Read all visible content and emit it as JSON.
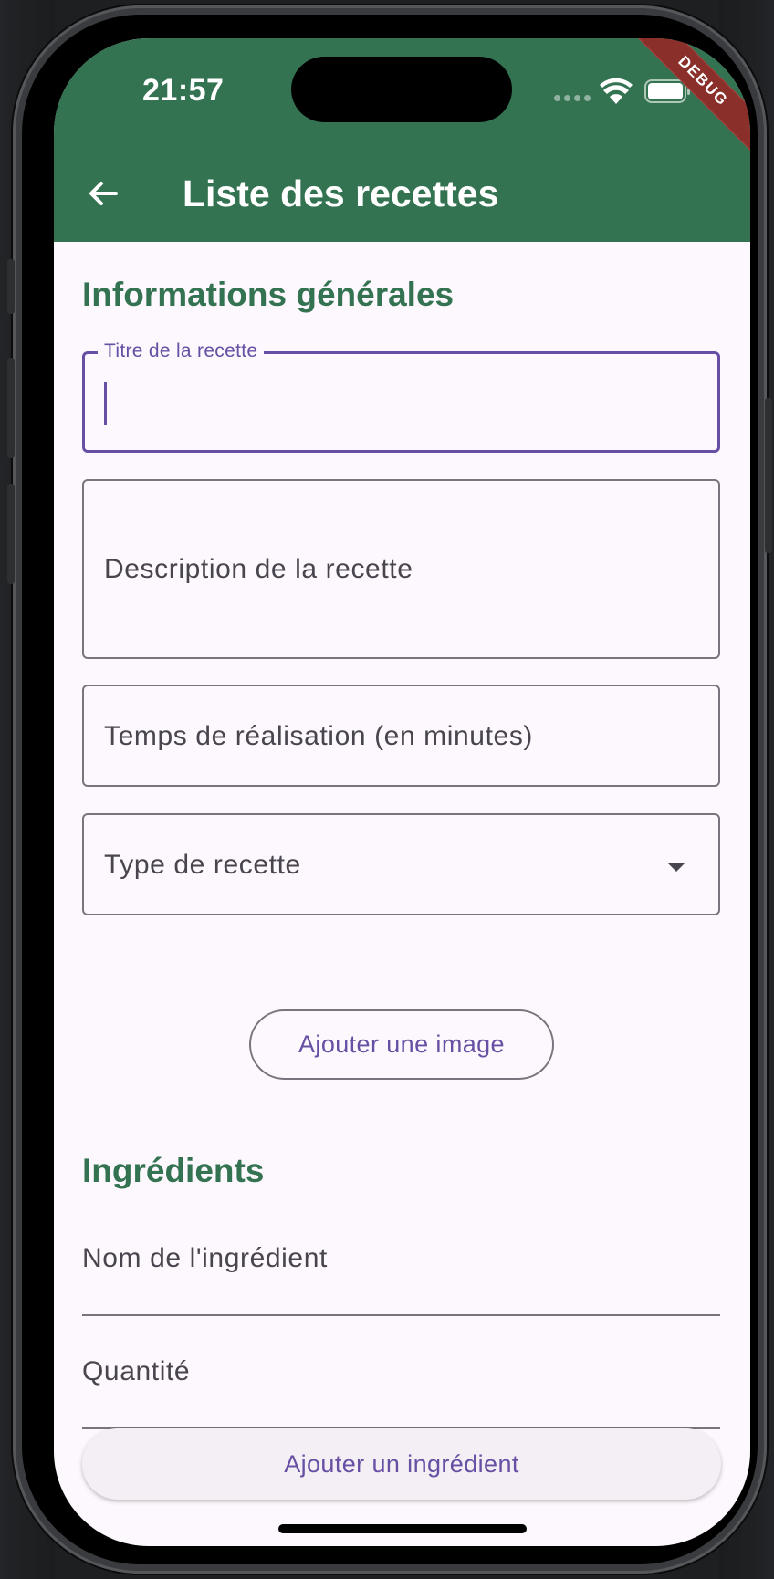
{
  "status_bar": {
    "time": "21:57",
    "icons": [
      "signal-dots",
      "wifi-icon",
      "battery-icon"
    ],
    "debug_banner": "DEBUG"
  },
  "app_bar": {
    "back_icon": "arrow-back-icon",
    "title": "Liste des recettes"
  },
  "general_section": {
    "title": "Informations générales",
    "recipe_title_field": {
      "label": "Titre de la recette",
      "value": ""
    },
    "description_field": {
      "placeholder": "Description de la recette"
    },
    "time_field": {
      "placeholder": "Temps de réalisation (en minutes)"
    },
    "type_dropdown": {
      "placeholder": "Type de recette",
      "icon": "dropdown-arrow-icon"
    },
    "add_image_button": "Ajouter une image"
  },
  "ingredients_section": {
    "title": "Ingrédients",
    "name_field": {
      "placeholder": "Nom de l'ingrédient"
    },
    "quantity_field": {
      "placeholder": "Quantité"
    },
    "add_ingredient_button": "Ajouter un ingrédient"
  },
  "colors": {
    "app_bar": "#347352",
    "section_title": "#347352",
    "focus": "#6750a4",
    "surface": "#fdf8fd",
    "debug_ribbon": "#8a2f2a"
  }
}
